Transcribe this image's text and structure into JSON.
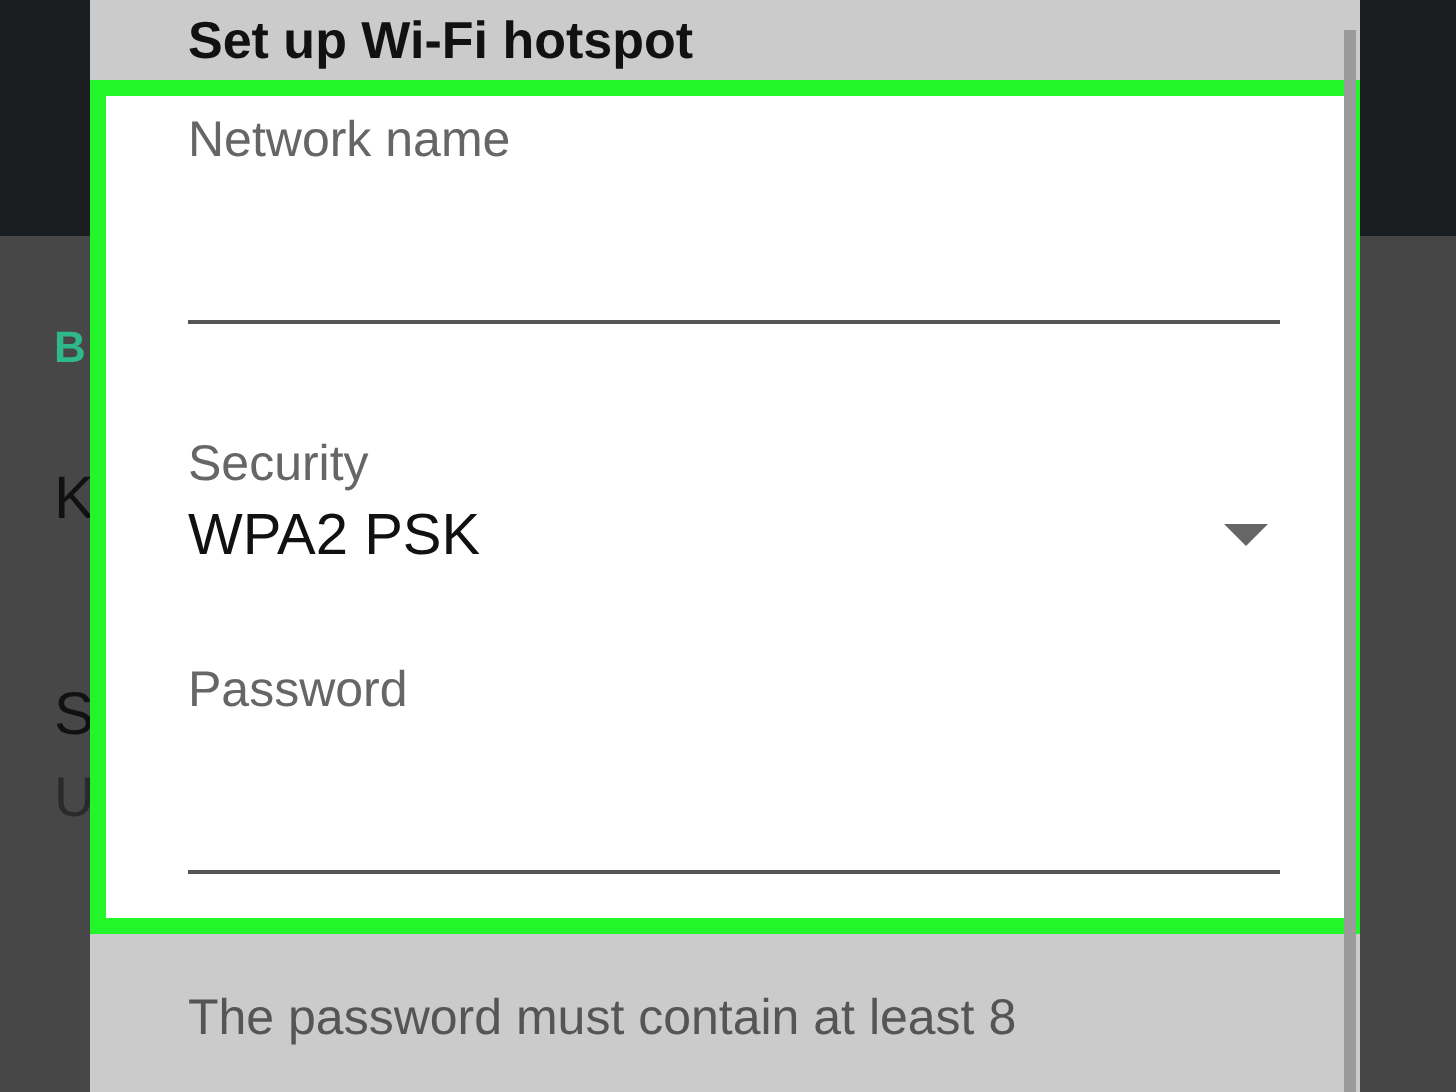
{
  "background": {
    "rows": [
      {
        "kind": "header",
        "text": "B"
      },
      {
        "kind": "title",
        "text": "K"
      },
      {
        "kind": "title",
        "text": "S"
      },
      {
        "kind": "subtitle",
        "text": "U"
      }
    ]
  },
  "dialog": {
    "title": "Set up Wi-Fi hotspot",
    "highlighted": true,
    "fields": [
      {
        "kind": "text",
        "label": "Network name"
      },
      {
        "kind": "dropdown",
        "label": "Security",
        "value": "WPA2 PSK"
      },
      {
        "kind": "password",
        "label": "Password"
      }
    ],
    "helper_text": "The password must contain at least 8"
  }
}
